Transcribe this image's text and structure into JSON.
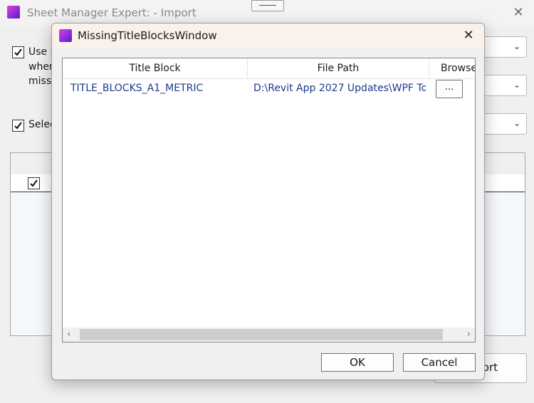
{
  "background_window": {
    "title": "Sheet Manager Expert: - Import",
    "close_glyph": "✕",
    "use_checkbox_label": "Use p",
    "line2_fragment": "wher",
    "line3_fragment": "missi",
    "select_checkbox_label": "Selec",
    "partial_button_label": "ort",
    "checkbox_checked": true
  },
  "dialog": {
    "title": "MissingTitleBlocksWindow",
    "close_glyph": "✕",
    "columns": [
      "Title Block",
      "File Path",
      "Browse"
    ],
    "rows": [
      {
        "title_block": "TITLE_BLOCKS_A1_METRIC",
        "file_path": "D:\\Revit App 2027 Updates\\WPF To",
        "browse_label": "..."
      }
    ],
    "ok_label": "OK",
    "cancel_label": "Cancel"
  },
  "icons": {
    "app_icon": "purple-gradient-square",
    "chevron": "chevron-down-icon",
    "scroll_left": "‹",
    "scroll_right": "›"
  }
}
